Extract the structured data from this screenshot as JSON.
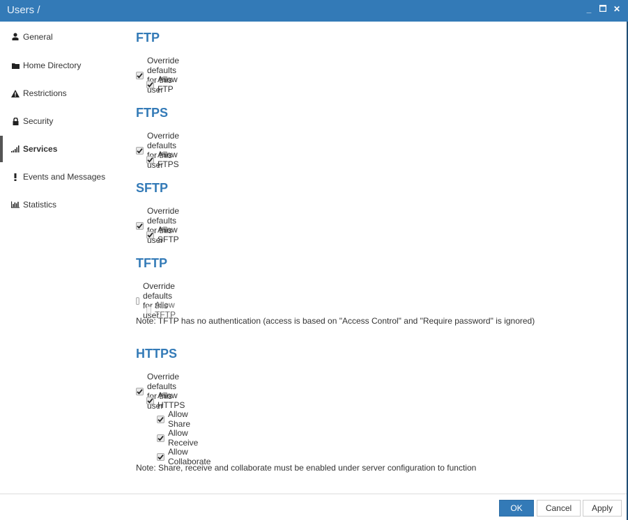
{
  "window": {
    "title": "Users /",
    "controls": {
      "minimize": "_",
      "maximize": "☐",
      "close": "✕"
    }
  },
  "sidebar": {
    "items": [
      {
        "label": "General",
        "icon": "user-icon",
        "active": false
      },
      {
        "label": "Home Directory",
        "icon": "folder-icon",
        "active": false
      },
      {
        "label": "Restrictions",
        "icon": "warning-icon",
        "active": false
      },
      {
        "label": "Security",
        "icon": "lock-icon",
        "active": false
      },
      {
        "label": "Services",
        "icon": "signal-icon",
        "active": true
      },
      {
        "label": "Events and Messages",
        "icon": "exclamation-icon",
        "active": false
      },
      {
        "label": "Statistics",
        "icon": "bar-chart-icon",
        "active": false
      }
    ]
  },
  "sections": {
    "ftp": {
      "title": "FTP",
      "override": {
        "label": "Override defaults for this user",
        "checked": true
      },
      "allow": {
        "label": "Allow FTP",
        "checked": true
      }
    },
    "ftps": {
      "title": "FTPS",
      "override": {
        "label": "Override defaults for this user",
        "checked": true
      },
      "allow": {
        "label": "Allow FTPS",
        "checked": true
      }
    },
    "sftp": {
      "title": "SFTP",
      "override": {
        "label": "Override defaults for this user",
        "checked": true
      },
      "allow": {
        "label": "Allow SFTP",
        "checked": true
      }
    },
    "tftp": {
      "title": "TFTP",
      "override": {
        "label": "Override defaults for this user",
        "checked": false
      },
      "allow": {
        "label": "Allow TFTP",
        "checked": false,
        "disabled": true
      },
      "note": "Note: TFTP has no authentication (access is based on \"Access Control\" and \"Require password\" is ignored)"
    },
    "https": {
      "title": "HTTPS",
      "override": {
        "label": "Override defaults for this user",
        "checked": true
      },
      "allow": {
        "label": "Allow HTTPS",
        "checked": true
      },
      "share": {
        "label": "Allow Share",
        "checked": true
      },
      "receive": {
        "label": "Allow Receive",
        "checked": true
      },
      "collaborate": {
        "label": "Allow Collaborate",
        "checked": true
      },
      "note": "Note: Share, receive and collaborate must be enabled under server configuration to function"
    }
  },
  "footer": {
    "ok": "OK",
    "cancel": "Cancel",
    "apply": "Apply"
  },
  "colors": {
    "accent": "#337ab7",
    "titlebar": "#337ab7"
  }
}
